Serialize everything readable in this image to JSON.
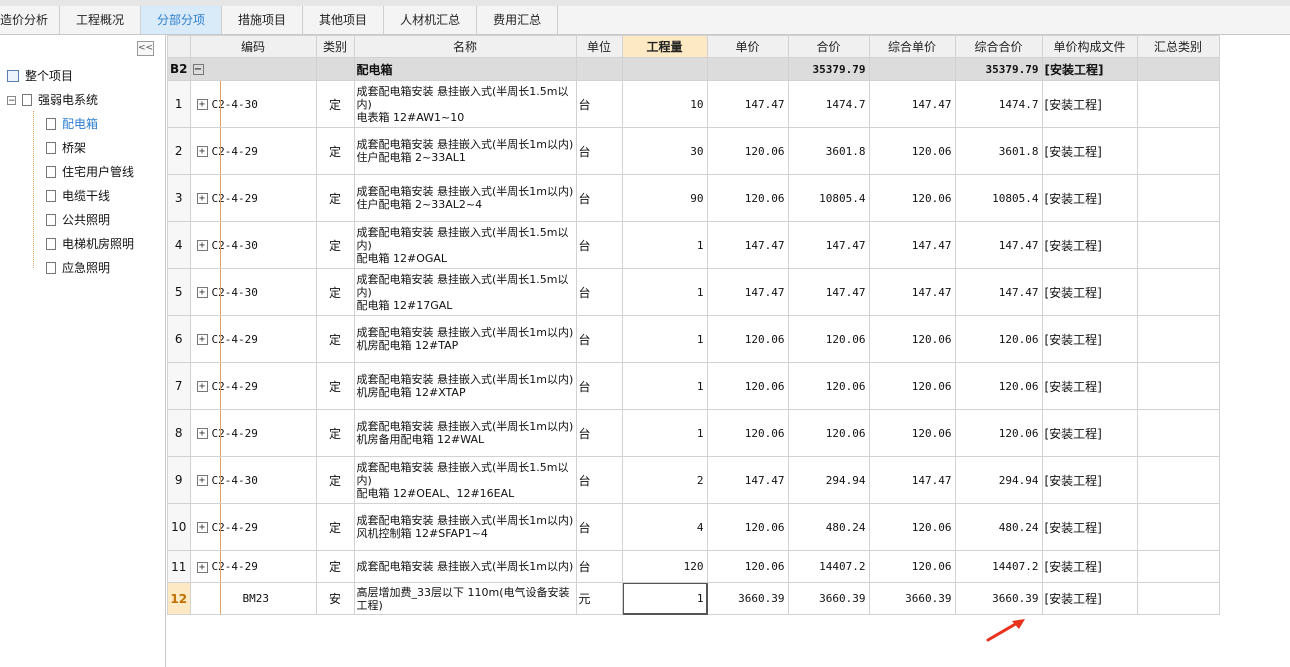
{
  "tabs": [
    "造价分析",
    "工程概况",
    "分部分项",
    "措施项目",
    "其他项目",
    "人材机汇总",
    "费用汇总"
  ],
  "active_tab": 2,
  "sidebar": {
    "collapse_label": "<<",
    "root": "整个项目",
    "group": "强弱电系统",
    "items": [
      "配电箱",
      "桥架",
      "住宅用户管线",
      "电缆干线",
      "公共照明",
      "电梯机房照明",
      "应急照明"
    ],
    "selected_index": 0
  },
  "columns": [
    "",
    "编码",
    "类别",
    "名称",
    "单位",
    "工程量",
    "单价",
    "合价",
    "综合单价",
    "综合合价",
    "单价构成文件",
    "汇总类别"
  ],
  "group_row": {
    "id": "B2",
    "name": "配电箱",
    "total": "35379.79",
    "comp_total": "35379.79",
    "file": "[安装工程]"
  },
  "rows": [
    {
      "no": "1",
      "code": "C2-4-30",
      "type": "定",
      "name1": "成套配电箱安装 悬挂嵌入式(半周长1.5m以内)",
      "name2": "电表箱 12#AW1~10",
      "unit": "台",
      "qty": "10",
      "price": "147.47",
      "total": "1474.7",
      "cprice": "147.47",
      "ctotal": "1474.7",
      "file": "[安装工程]"
    },
    {
      "no": "2",
      "code": "C2-4-29",
      "type": "定",
      "name1": "成套配电箱安装 悬挂嵌入式(半周长1m以内)",
      "name2": "住户配电箱 2~33AL1",
      "unit": "台",
      "qty": "30",
      "price": "120.06",
      "total": "3601.8",
      "cprice": "120.06",
      "ctotal": "3601.8",
      "file": "[安装工程]"
    },
    {
      "no": "3",
      "code": "C2-4-29",
      "type": "定",
      "name1": "成套配电箱安装 悬挂嵌入式(半周长1m以内)",
      "name2": "住户配电箱 2~33AL2~4",
      "unit": "台",
      "qty": "90",
      "price": "120.06",
      "total": "10805.4",
      "cprice": "120.06",
      "ctotal": "10805.4",
      "file": "[安装工程]"
    },
    {
      "no": "4",
      "code": "C2-4-30",
      "type": "定",
      "name1": "成套配电箱安装 悬挂嵌入式(半周长1.5m以内)",
      "name2": "配电箱 12#OGAL",
      "unit": "台",
      "qty": "1",
      "price": "147.47",
      "total": "147.47",
      "cprice": "147.47",
      "ctotal": "147.47",
      "file": "[安装工程]"
    },
    {
      "no": "5",
      "code": "C2-4-30",
      "type": "定",
      "name1": "成套配电箱安装 悬挂嵌入式(半周长1.5m以内)",
      "name2": "配电箱 12#17GAL",
      "unit": "台",
      "qty": "1",
      "price": "147.47",
      "total": "147.47",
      "cprice": "147.47",
      "ctotal": "147.47",
      "file": "[安装工程]"
    },
    {
      "no": "6",
      "code": "C2-4-29",
      "type": "定",
      "name1": "成套配电箱安装 悬挂嵌入式(半周长1m以内)",
      "name2": "机房配电箱 12#TAP",
      "unit": "台",
      "qty": "1",
      "price": "120.06",
      "total": "120.06",
      "cprice": "120.06",
      "ctotal": "120.06",
      "file": "[安装工程]"
    },
    {
      "no": "7",
      "code": "C2-4-29",
      "type": "定",
      "name1": "成套配电箱安装 悬挂嵌入式(半周长1m以内)",
      "name2": "机房配电箱 12#XTAP",
      "unit": "台",
      "qty": "1",
      "price": "120.06",
      "total": "120.06",
      "cprice": "120.06",
      "ctotal": "120.06",
      "file": "[安装工程]"
    },
    {
      "no": "8",
      "code": "C2-4-29",
      "type": "定",
      "name1": "成套配电箱安装 悬挂嵌入式(半周长1m以内)",
      "name2": "机房备用配电箱 12#WAL",
      "unit": "台",
      "qty": "1",
      "price": "120.06",
      "total": "120.06",
      "cprice": "120.06",
      "ctotal": "120.06",
      "file": "[安装工程]"
    },
    {
      "no": "9",
      "code": "C2-4-30",
      "type": "定",
      "name1": "成套配电箱安装 悬挂嵌入式(半周长1.5m以内)",
      "name2": "配电箱 12#OEAL、12#16EAL",
      "unit": "台",
      "qty": "2",
      "price": "147.47",
      "total": "294.94",
      "cprice": "147.47",
      "ctotal": "294.94",
      "file": "[安装工程]"
    },
    {
      "no": "10",
      "code": "C2-4-29",
      "type": "定",
      "name1": "成套配电箱安装 悬挂嵌入式(半周长1m以内)",
      "name2": "风机控制箱 12#SFAP1~4",
      "unit": "台",
      "qty": "4",
      "price": "120.06",
      "total": "480.24",
      "cprice": "120.06",
      "ctotal": "480.24",
      "file": "[安装工程]"
    },
    {
      "no": "11",
      "code": "C2-4-29",
      "type": "定",
      "name1": "成套配电箱安装 悬挂嵌入式(半周长1m以内)",
      "name2": "",
      "unit": "台",
      "qty": "120",
      "price": "120.06",
      "total": "14407.2",
      "cprice": "120.06",
      "ctotal": "14407.2",
      "file": "[安装工程]"
    },
    {
      "no": "12",
      "code": "BM23",
      "type": "安",
      "name1": "高层增加费_33层以下 110m(电气设备安装工程)",
      "name2": "",
      "unit": "元",
      "qty": "1",
      "price": "3660.39",
      "total": "3660.39",
      "cprice": "3660.39",
      "ctotal": "3660.39",
      "file": "[安装工程]"
    }
  ],
  "colors": {
    "active_tab_bg": "#d9eaf8",
    "accent": "#2f7fd0",
    "highlight_header": "#fde9c4",
    "arrow": "#e8321e"
  }
}
